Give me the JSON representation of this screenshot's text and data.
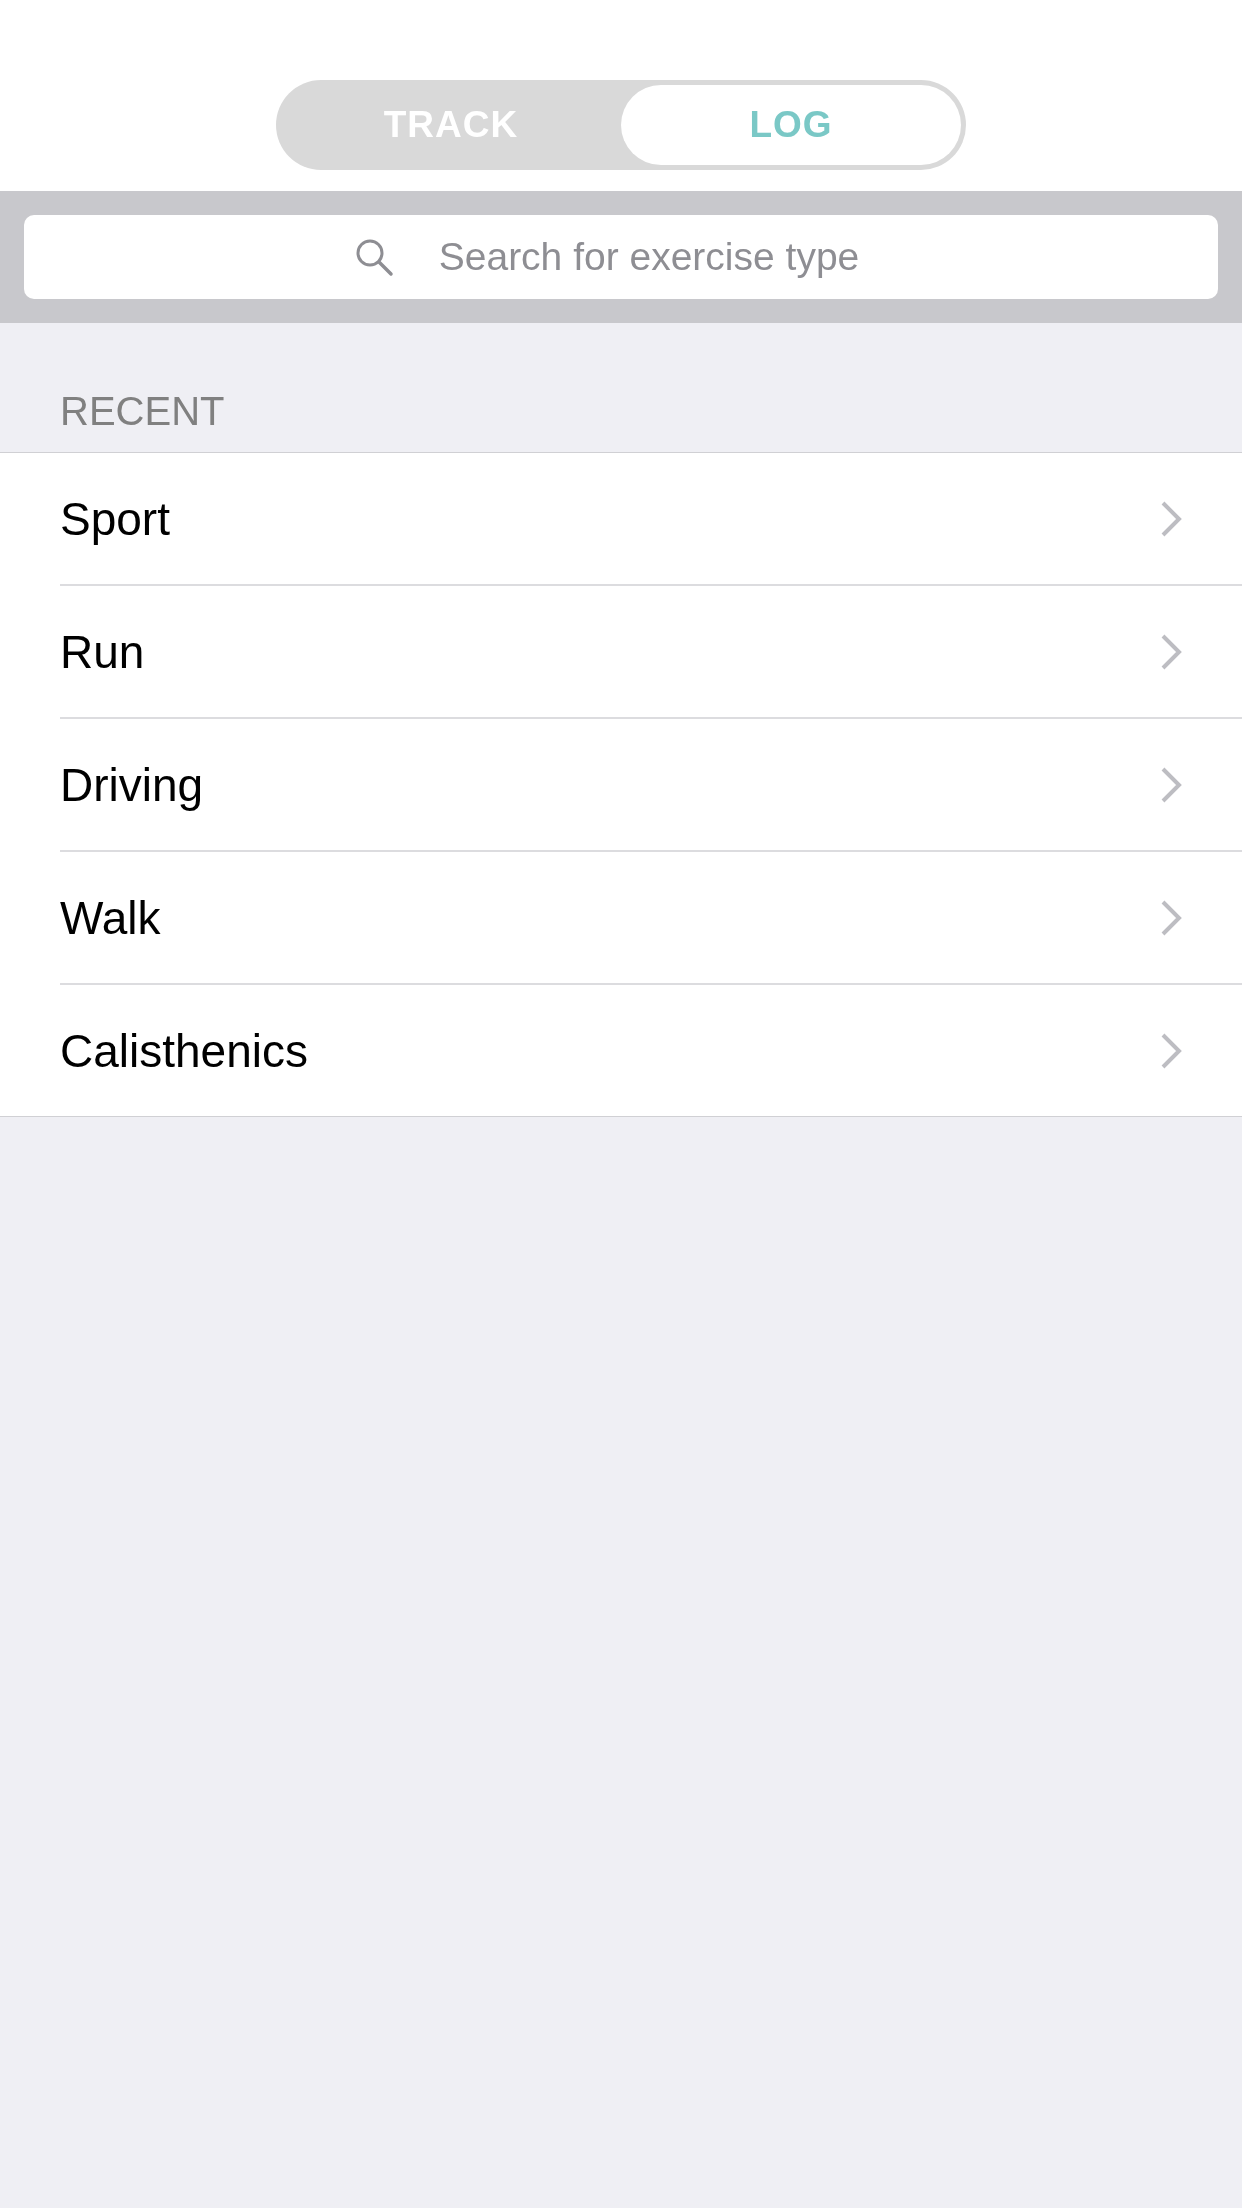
{
  "tabs": [
    {
      "label": "TRACK",
      "selected": false
    },
    {
      "label": "LOG",
      "selected": true
    }
  ],
  "search": {
    "placeholder": "Search for exercise type"
  },
  "section": {
    "title": "RECENT"
  },
  "items": [
    {
      "label": "Sport"
    },
    {
      "label": "Run"
    },
    {
      "label": "Driving"
    },
    {
      "label": "Walk"
    },
    {
      "label": "Calisthenics"
    }
  ]
}
